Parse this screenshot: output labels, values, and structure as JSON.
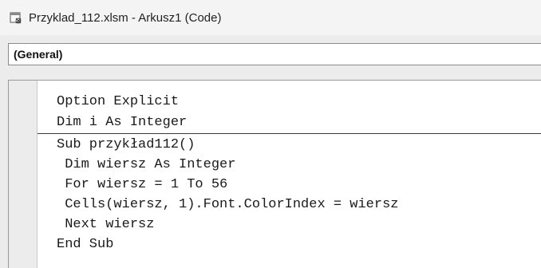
{
  "window": {
    "title": "Przyklad_112.xlsm - Arkusz1 (Code)"
  },
  "object_dropdown": {
    "selected": "(General)"
  },
  "code": {
    "declarations": [
      "Option Explicit",
      "Dim i As Integer"
    ],
    "procedure": [
      "Sub przykład112()",
      " Dim wiersz As Integer",
      " For wiersz = 1 To 56",
      " Cells(wiersz, 1).Font.ColorIndex = wiersz",
      " Next wiersz",
      "End Sub"
    ]
  }
}
